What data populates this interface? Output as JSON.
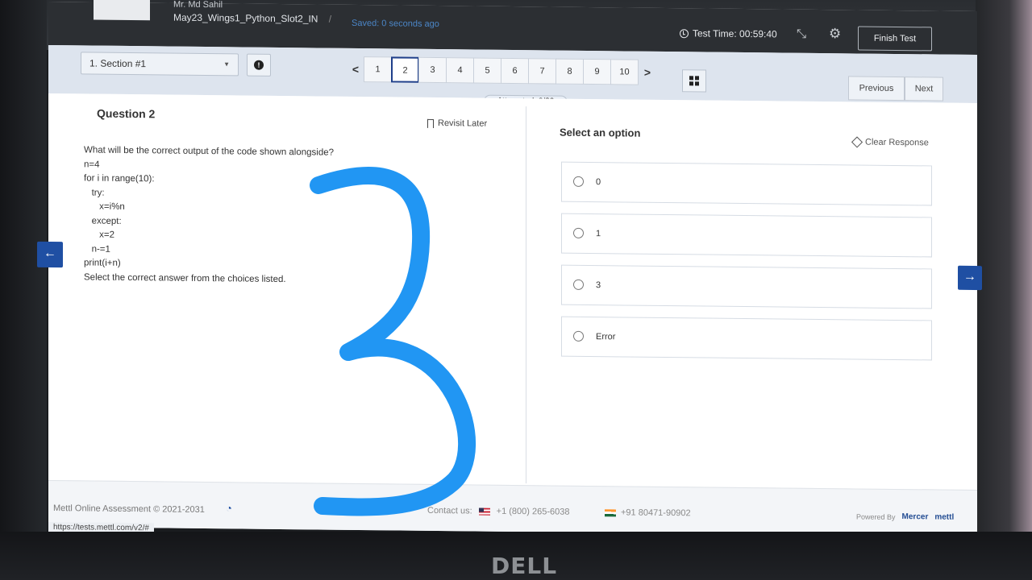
{
  "header": {
    "user_name": "Mr. Md Sahil",
    "test_name": "May23_Wings1_Python_Slot2_IN",
    "separator": "/",
    "saved_status": "Saved: 0 seconds ago",
    "test_time_label": "Test Time: 00:59:40",
    "finish_label": "Finish Test",
    "icons": [
      "clock-icon",
      "compress-icon",
      "gear-icon"
    ]
  },
  "toolbar": {
    "section": "1. Section #1",
    "pages": [
      "1",
      "2",
      "3",
      "4",
      "5",
      "6",
      "7",
      "8",
      "9",
      "10"
    ],
    "active_page": "2",
    "prev_arrow": "<",
    "next_arrow": ">",
    "attempted": "Attempted: 0/23",
    "previous_label": "Previous",
    "next_label": "Next"
  },
  "question": {
    "title": "Question 2",
    "revisit_label": "Revisit Later",
    "lines": [
      "What will be the correct output of the code shown alongside?",
      "n=4",
      "for i in range(10):",
      "   try:",
      "      x=i%n",
      "   except:",
      "      x=2",
      "   n-=1",
      "print(i+n)",
      "Select the correct answer from the choices listed."
    ]
  },
  "answers": {
    "heading": "Select an option",
    "clear_label": "Clear Response",
    "options": [
      "0",
      "1",
      "3",
      "Error"
    ]
  },
  "footer": {
    "copyright": "Mettl Online Assessment © 2021-2031",
    "contact_prefix": "Contact us:",
    "phone_us": "+1 (800) 265-6038",
    "phone_in": "+91 80471-90902",
    "powered_by": "Powered By",
    "brand1": "Mercer",
    "brand2": "mettl",
    "status_url": "https://tests.mettl.com/v2/#"
  },
  "bezel_brand": "DELL",
  "colors": {
    "accent": "#1f4fa3",
    "annotation_blue": "#2196f3",
    "header_bg": "#2c2f33"
  }
}
